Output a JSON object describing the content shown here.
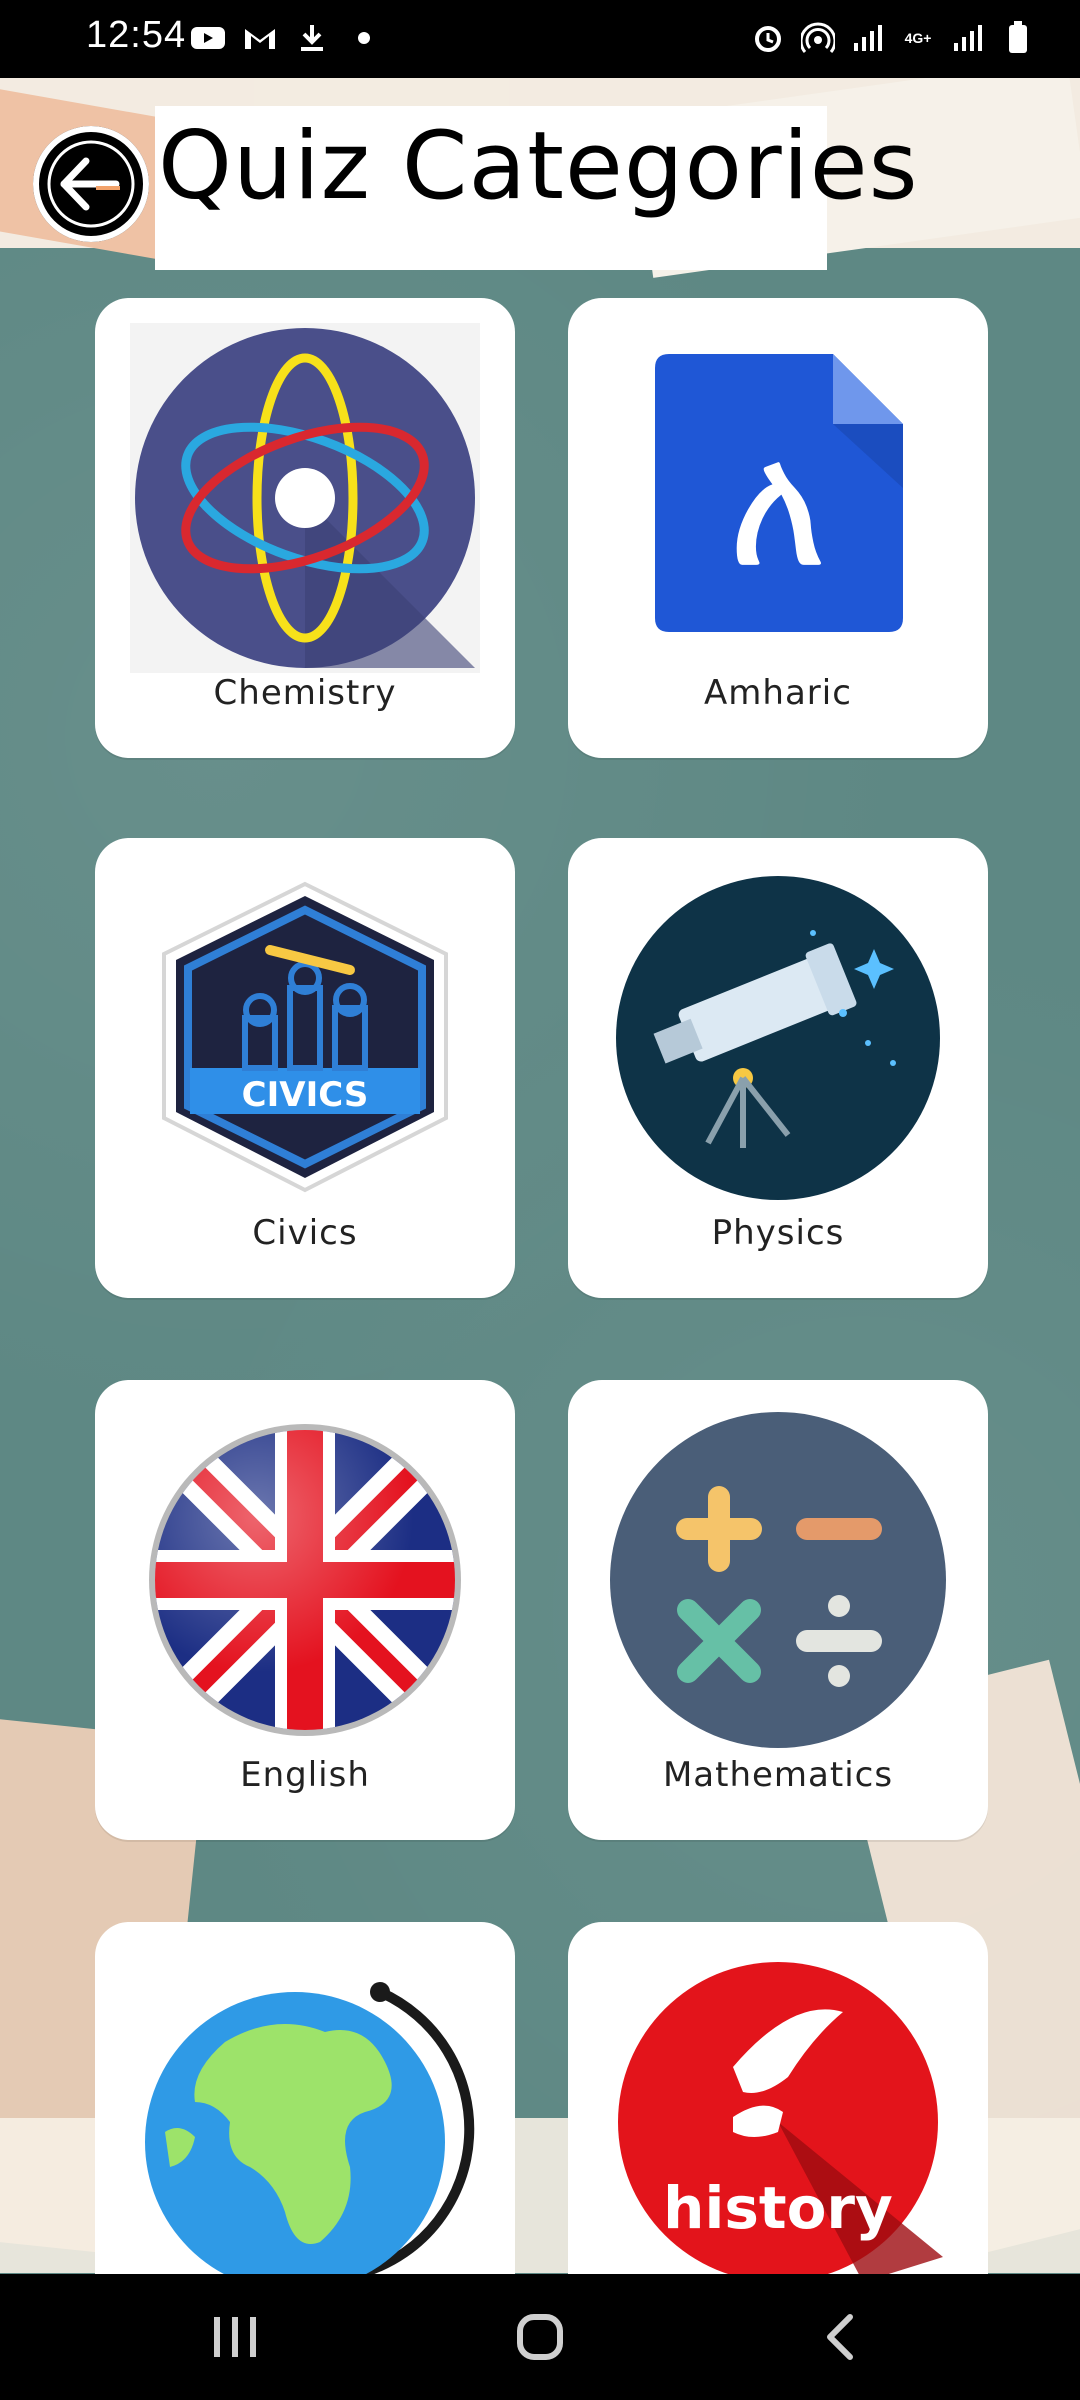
{
  "status_bar": {
    "time": "12:54",
    "left_icons": [
      "youtube-icon",
      "gmail-icon",
      "download-icon",
      "dot-icon"
    ],
    "right_icons": [
      "alarm-icon",
      "hotspot-icon",
      "signal-icon",
      "4g-icon",
      "signal2-icon",
      "battery-icon"
    ],
    "network_label": "4G+"
  },
  "header": {
    "title": "Quiz Categories"
  },
  "categories": [
    {
      "label": "Chemistry",
      "icon": "atom-icon"
    },
    {
      "label": "Amharic",
      "icon": "amharic-document-icon"
    },
    {
      "label": "Civics",
      "icon": "civics-badge-icon",
      "badge_text": "CIVICS"
    },
    {
      "label": "Physics",
      "icon": "telescope-icon"
    },
    {
      "label": "English",
      "icon": "uk-flag-icon"
    },
    {
      "label": "Mathematics",
      "icon": "math-operators-icon"
    },
    {
      "label": "",
      "icon": "globe-icon"
    },
    {
      "label": "",
      "icon": "history-icon",
      "badge_text": "history"
    }
  ],
  "amharic_glyph": "ለ",
  "colors": {
    "chalkboard": "#5e8884",
    "card": "#ffffff",
    "statusbar": "#000000"
  },
  "nav": {
    "recents": "recents-icon",
    "home": "home-icon",
    "back": "back-icon"
  }
}
